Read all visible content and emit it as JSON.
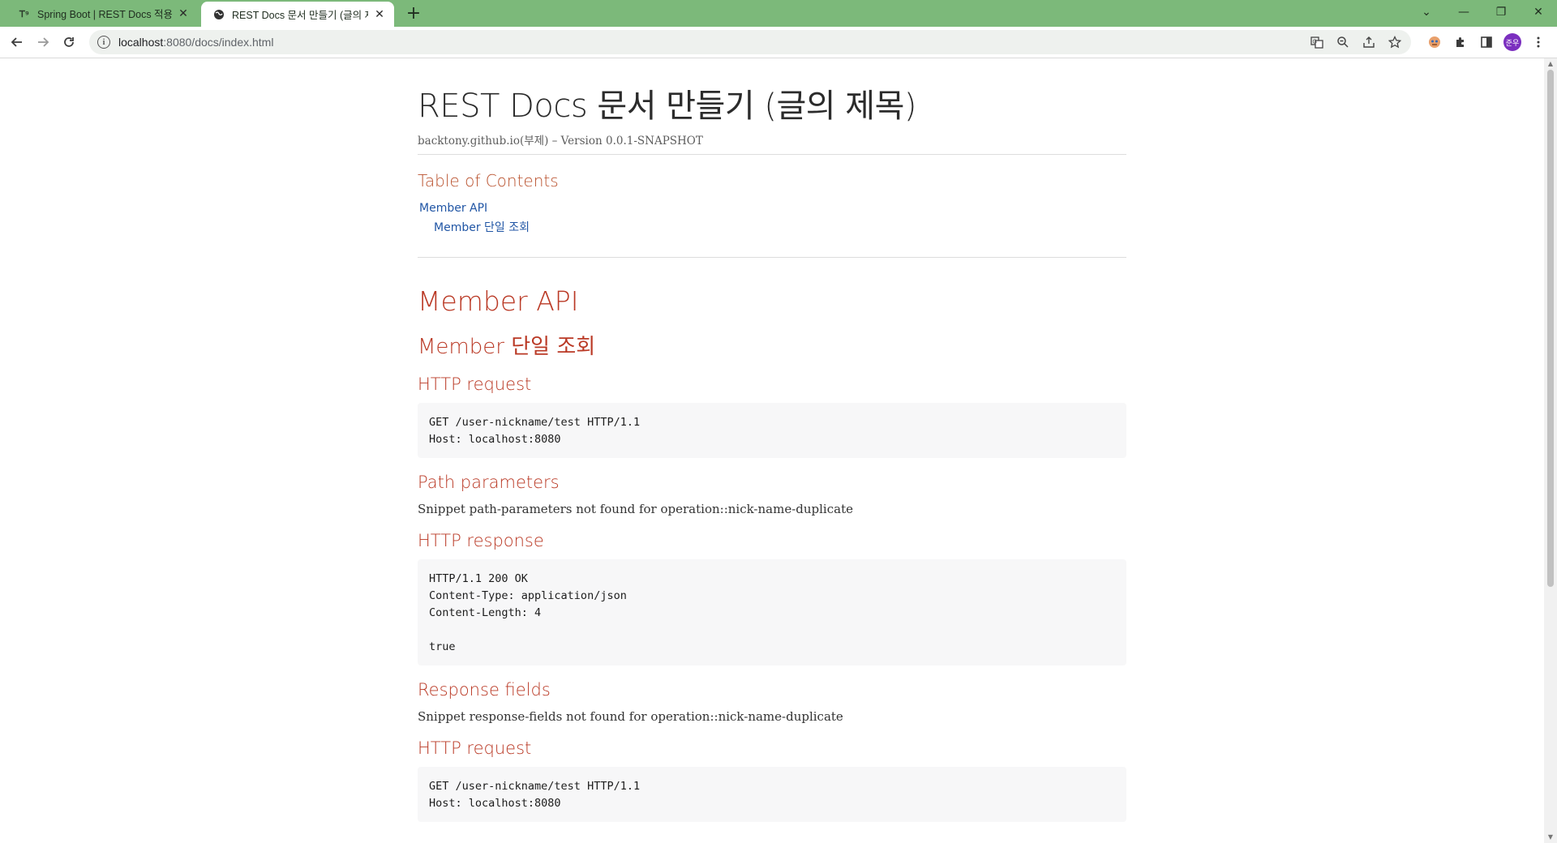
{
  "browser": {
    "tabs": [
      {
        "title": "Spring Boot | REST Docs 적용하",
        "active": false
      },
      {
        "title": "REST Docs 문서 만들기 (글의 제",
        "active": true
      }
    ],
    "new_tab_label": "+",
    "address": {
      "host": "localhost",
      "path": ":8080/docs/index.html"
    },
    "window_controls": {
      "tablist": "⌄",
      "minimize": "—",
      "restore": "❐",
      "close": "✕"
    }
  },
  "page": {
    "title": "REST Docs 문서 만들기 (글의 제목)",
    "details": "backtony.github.io(부제) – Version 0.0.1-SNAPSHOT",
    "toc": {
      "title": "Table of Contents",
      "items": [
        {
          "label": "Member API",
          "level": 1
        },
        {
          "label": "Member 단일 조회",
          "level": 2
        }
      ]
    },
    "sections": {
      "h2": "Member API",
      "h3": "Member 단일 조회",
      "http_request_title": "HTTP request",
      "http_request_code": "GET /user-nickname/test HTTP/1.1\nHost: localhost:8080",
      "path_params_title": "Path parameters",
      "path_params_text": "Snippet path-parameters not found for operation::nick-name-duplicate",
      "http_response_title": "HTTP response",
      "http_response_code": "HTTP/1.1 200 OK\nContent-Type: application/json\nContent-Length: 4\n\ntrue",
      "response_fields_title": "Response fields",
      "response_fields_text": "Snippet response-fields not found for operation::nick-name-duplicate",
      "http_request2_title": "HTTP request",
      "http_request2_code": "GET /user-nickname/test HTTP/1.1\nHost: localhost:8080"
    }
  },
  "profile": {
    "initials": "준우"
  },
  "colors": {
    "tabbar": "#7cb97a",
    "heading": "#ba3925",
    "link": "#2156a5",
    "avatar": "#7b2fbf"
  }
}
